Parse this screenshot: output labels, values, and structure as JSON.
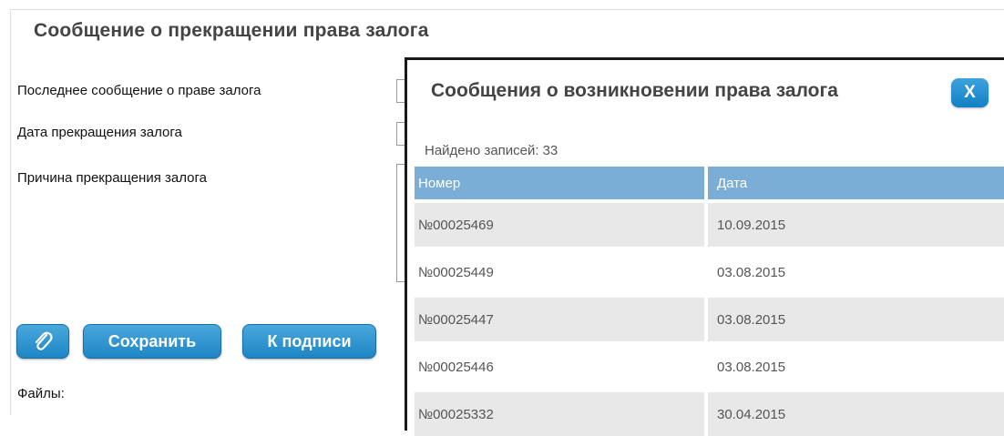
{
  "page": {
    "title": "Сообщение о прекращении права залога"
  },
  "form": {
    "labels": {
      "last_message": "Последнее сообщение о праве залога",
      "end_date": "Дата прекращения залога",
      "reason": "Причина прекращения залога"
    },
    "files_label": "Файлы:"
  },
  "buttons": {
    "attach_icon": "paperclip-icon",
    "save": "Сохранить",
    "sign": "К подписи"
  },
  "modal": {
    "title": "Сообщения о возникновении права залога",
    "close_label": "X",
    "count_label": "Найдено записей:",
    "count_value": "33",
    "columns": [
      "Номер",
      "Дата"
    ],
    "rows": [
      {
        "number": "№00025469",
        "date": "10.09.2015"
      },
      {
        "number": "№00025449",
        "date": "03.08.2015"
      },
      {
        "number": "№00025447",
        "date": "03.08.2015"
      },
      {
        "number": "№00025446",
        "date": "03.08.2015"
      },
      {
        "number": "№00025332",
        "date": "30.04.2015"
      }
    ]
  },
  "colors": {
    "accent": "#1d86c5",
    "table_header": "#7aaed6",
    "row_alt": "#e8e8e8"
  }
}
